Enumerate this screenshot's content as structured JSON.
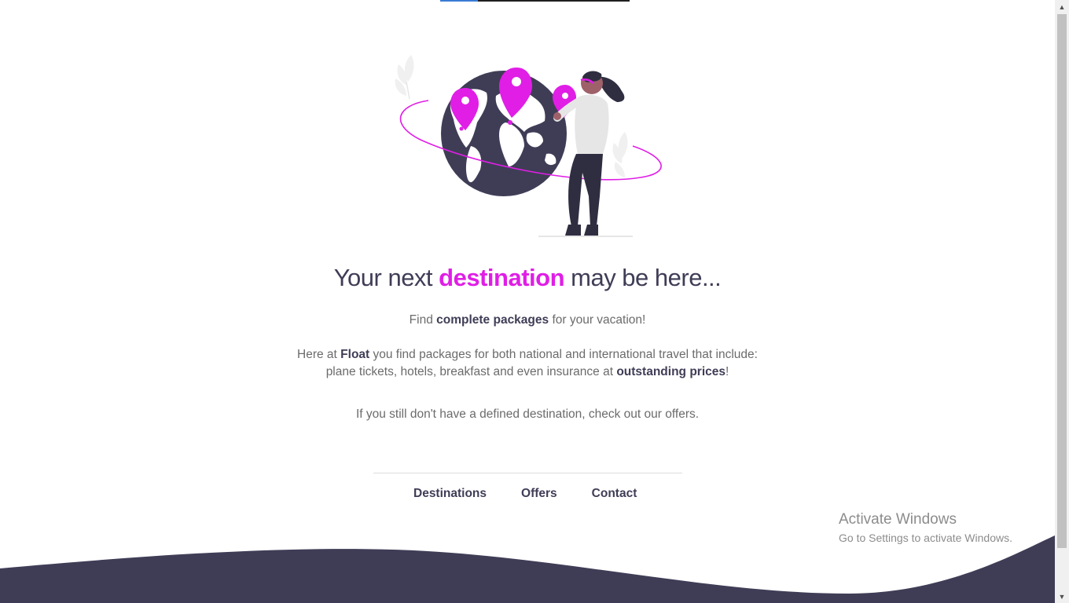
{
  "loader": {
    "progress_fraction": 0.2
  },
  "colors": {
    "accent": "#e01ee6",
    "dark": "#3f3d56",
    "text": "#6b6b6b"
  },
  "hero": {
    "illustration_icon": "woman-pinning-globe-illustration",
    "headline_before": "Your next ",
    "headline_accent": "destination",
    "headline_after": " may be here..."
  },
  "intro": {
    "p1_before": "Find ",
    "p1_bold": "complete packages",
    "p1_after": " for your vacation!",
    "p2_before": "Here at ",
    "p2_bold1": "Float",
    "p2_mid": " you find packages for both national and international travel that include:",
    "p2_line2": "plane tickets, hotels, breakfast and even insurance at ",
    "p2_bold2": "outstanding prices",
    "p2_end": "!",
    "p3": "If you still don't have a defined destination, check out our offers."
  },
  "nav": {
    "items": [
      {
        "label": "Destinations"
      },
      {
        "label": "Offers"
      },
      {
        "label": "Contact"
      }
    ]
  },
  "watermark": {
    "title": "Activate Windows",
    "subtitle": "Go to Settings to activate Windows."
  },
  "scrollbar": {
    "up_icon": "chevron-up-icon",
    "down_icon": "chevron-down-icon"
  }
}
